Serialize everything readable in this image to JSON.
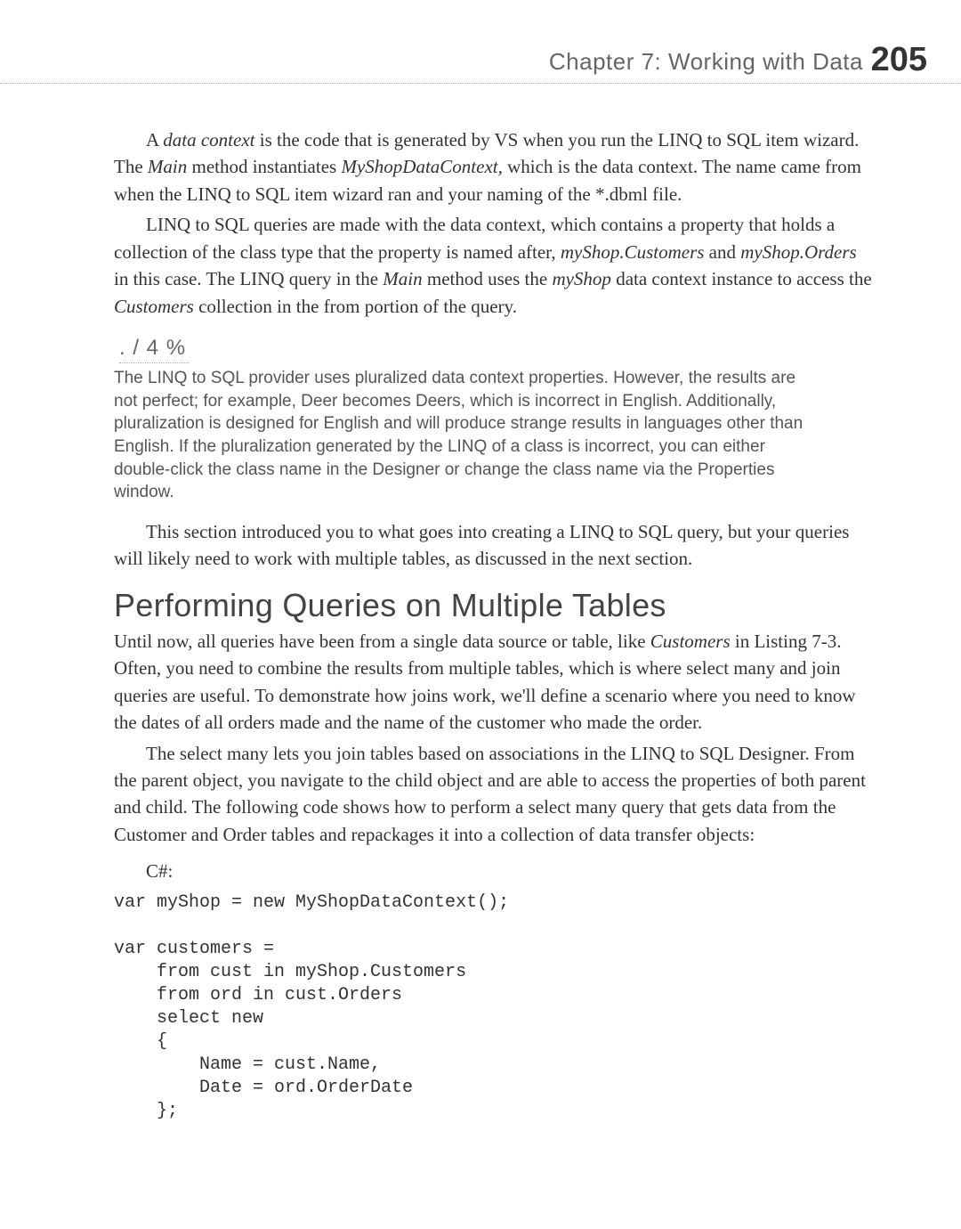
{
  "header": {
    "chapter": "Chapter 7:   Working with Data",
    "page": "205"
  },
  "para1_pre": "A ",
  "para1_term": "data context",
  "para1_mid1": " is the code that is generated by VS when you run the LINQ to SQL item wizard. The ",
  "para1_main": "Main",
  "para1_mid2": " method instantiates ",
  "para1_ctx": "MyShopDataContext,",
  "para1_end": " which is the data context. The name came from when the LINQ to SQL item wizard ran and your naming of the *.dbml file.",
  "para2_pre": "LINQ to SQL queries are made with the data context, which contains a property that holds a collection of the class type that the property is named after, ",
  "para2_cust": "myShop.Customers",
  "para2_mid1": " and ",
  "para2_ord": "myShop.Orders",
  "para2_mid2": " in this case. The LINQ query in the ",
  "para2_main": "Main",
  "para2_mid3": " method uses the ",
  "para2_shop": "myShop",
  "para2_mid4": " data context instance to access the ",
  "para2_coll": "Customers",
  "para2_end": " collection in the from portion of the query.",
  "note_header": ". / 4 %",
  "note_body": "The LINQ to SQL provider uses pluralized data context properties. However, the results are not perfect; for example, Deer becomes Deers, which is incorrect in English. Additionally, pluralization is designed for English and will produce strange results in languages other than English. If the pluralization generated by the LINQ of a class is incorrect, you can either double-click the class name in the Designer or change the class name via the Properties window.",
  "para3": "This section introduced you to what goes into creating a LINQ to SQL query, but your queries will likely need to work with multiple tables, as discussed in the next section.",
  "heading": "Performing Queries on Multiple Tables",
  "para4_pre": "Until now, all queries have been from a single data source or table, like ",
  "para4_cust": "Customers",
  "para4_end": " in Listing 7-3. Often, you need to combine the results from multiple tables, which is where select many and join queries are useful. To demonstrate how joins work, we'll define a scenario where you need to know the dates of all orders made and the name of the customer who made the order.",
  "para5": "The select many lets you join tables based on associations in the LINQ to SQL Designer. From the parent object, you navigate to the child object and are able to access the properties of both parent and child. The following code shows how to perform a select many query that gets data from the Customer and Order tables and repackages it into a collection of data transfer objects:",
  "code_label": "C#:",
  "code": "var myShop = new MyShopDataContext();\n\nvar customers =\n    from cust in myShop.Customers\n    from ord in cust.Orders\n    select new\n    {\n        Name = cust.Name,\n        Date = ord.OrderDate\n    };"
}
